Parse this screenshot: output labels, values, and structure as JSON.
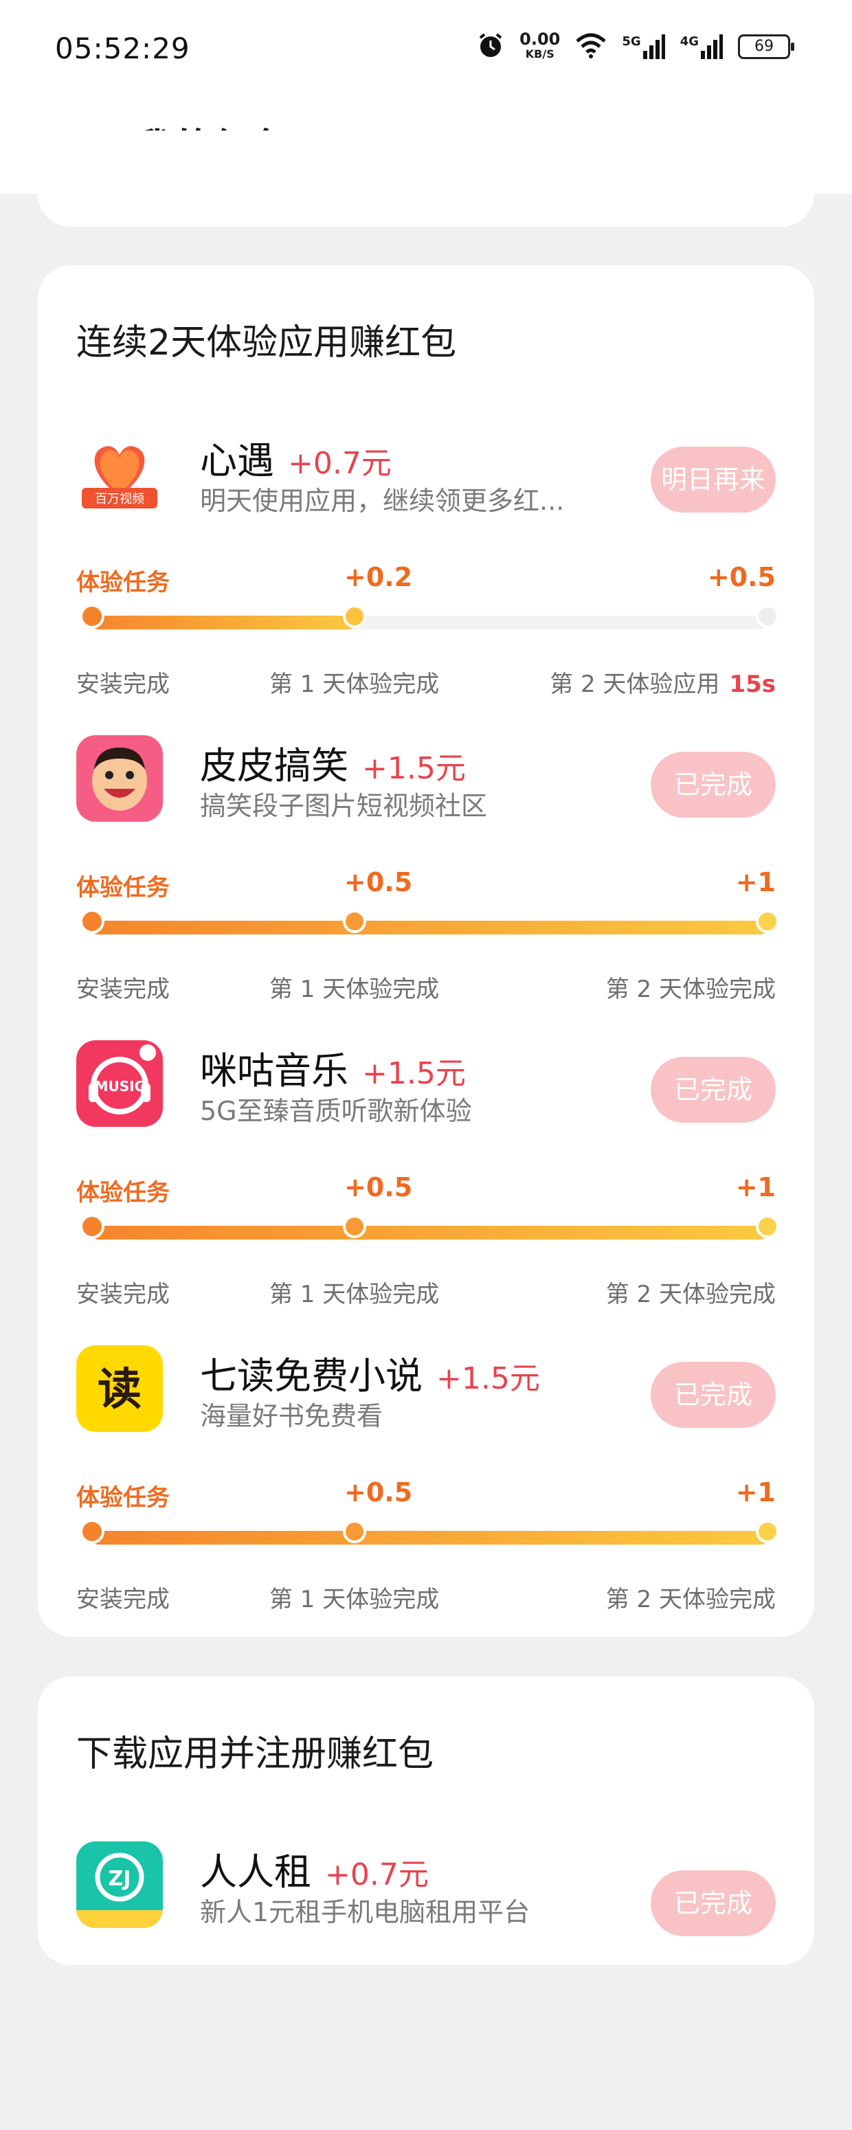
{
  "status_bar": {
    "time": "05:52:29",
    "speed_value": "0.00",
    "speed_unit": "KB/S",
    "sig1": "5G",
    "sig2": "4G",
    "battery": "69"
  },
  "header": {
    "title": "我的红包"
  },
  "sections": [
    {
      "title": "连续2天体验应用赚红包",
      "tasks": [
        {
          "name": "心遇",
          "reward": "+0.7元",
          "desc": "明天使用应用，继续领更多红...",
          "button": "明日再来",
          "task_label": "体验任务",
          "mid_reward": "+0.2",
          "end_reward": "+0.5",
          "progress": 0.39,
          "steps": [
            "安装完成",
            "第 1 天体验完成",
            "第 2 天体验应用"
          ],
          "timer": "15s",
          "icon_text": "百万视频"
        },
        {
          "name": "皮皮搞笑",
          "reward": "+1.5元",
          "desc": "搞笑段子图片短视频社区",
          "button": "已完成",
          "task_label": "体验任务",
          "mid_reward": "+0.5",
          "end_reward": "+1",
          "progress": 1,
          "steps": [
            "安装完成",
            "第 1 天体验完成",
            "第 2 天体验完成"
          ]
        },
        {
          "name": "咪咕音乐",
          "reward": "+1.5元",
          "desc": "5G至臻音质听歌新体验",
          "button": "已完成",
          "task_label": "体验任务",
          "mid_reward": "+0.5",
          "end_reward": "+1",
          "progress": 1,
          "steps": [
            "安装完成",
            "第 1 天体验完成",
            "第 2 天体验完成"
          ],
          "icon_text": "MUSIC"
        },
        {
          "name": "七读免费小说",
          "reward": "+1.5元",
          "desc": "海量好书免费看",
          "button": "已完成",
          "task_label": "体验任务",
          "mid_reward": "+0.5",
          "end_reward": "+1",
          "progress": 1,
          "steps": [
            "安装完成",
            "第 1 天体验完成",
            "第 2 天体验完成"
          ],
          "icon_text": "读"
        }
      ]
    },
    {
      "title": "下载应用并注册赚红包",
      "tasks": [
        {
          "name": "人人租",
          "reward": "+0.7元",
          "desc": "新人1元租手机电脑租用平台",
          "button": "已完成",
          "icon_text": "ZJ"
        }
      ]
    }
  ],
  "colors": {
    "accent_red": "#e8434d",
    "accent_orange": "#f06a1f",
    "button_bg": "#f9c2c4",
    "page_bg": "#f0f0f2"
  }
}
